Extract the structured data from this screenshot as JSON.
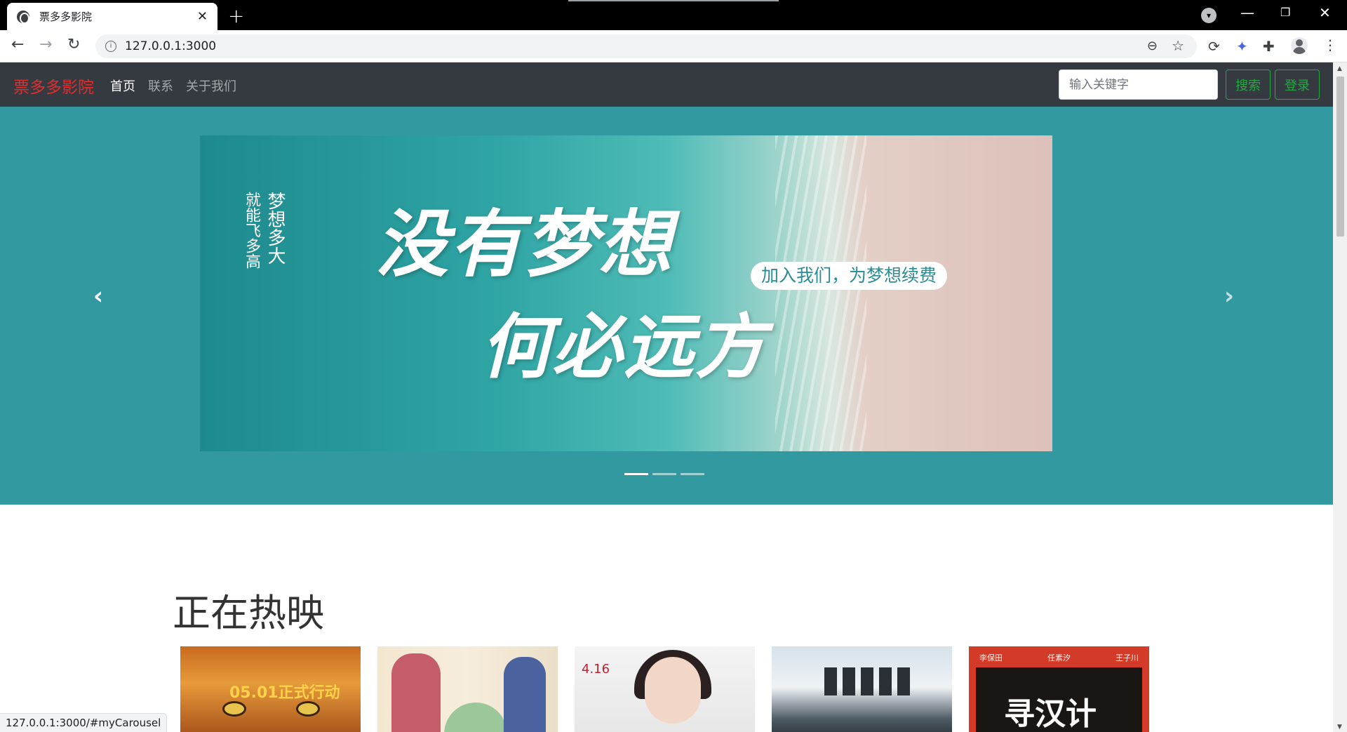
{
  "browser": {
    "tab_title": "票多多影院",
    "url": "127.0.0.1:3000",
    "status_url": "127.0.0.1:3000/#myCarousel"
  },
  "navbar": {
    "brand": "票多多影院",
    "links": [
      "首页",
      "联系",
      "关于我们"
    ],
    "active_index": 0,
    "search_placeholder": "输入关键字",
    "search_button": "搜索",
    "login_button": "登录"
  },
  "carousel": {
    "headline_1": "没有梦想",
    "headline_2": "何必远方",
    "vertical_text_1": "梦想多大",
    "vertical_text_2": "就能飞多高",
    "pill_text": "加入我们，为梦想续费",
    "slide_count": 3,
    "active_slide": 0
  },
  "section": {
    "title": "正在热映"
  },
  "posters": [
    {
      "text": "05.01正式行动"
    },
    {
      "text": ""
    },
    {
      "text": "4.16"
    },
    {
      "text": ""
    },
    {
      "text": "寻汉计",
      "names": [
        "李保田",
        "任素汐",
        "王子川"
      ]
    }
  ],
  "colors": {
    "navbar_bg": "#343a40",
    "brand": "#e22d2d",
    "carousel_bg": "#31999f",
    "success_outline": "#28a745"
  }
}
